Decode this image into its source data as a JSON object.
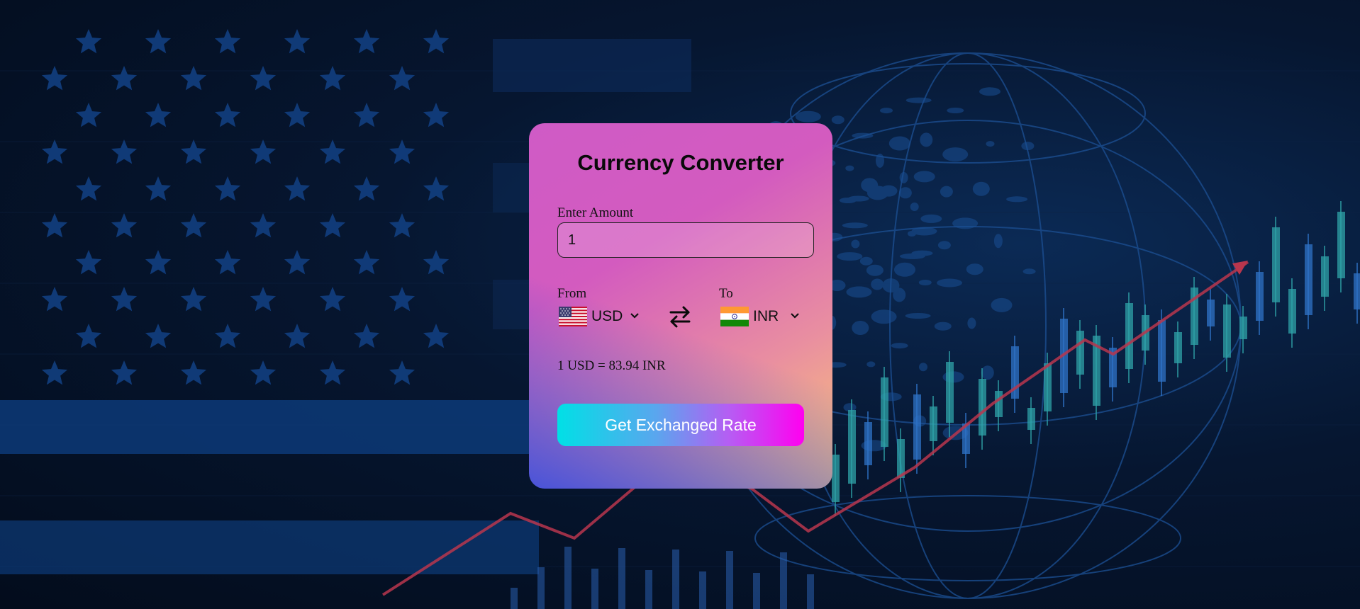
{
  "app": {
    "title": "Currency Converter"
  },
  "amount": {
    "label": "Enter Amount",
    "value": "1"
  },
  "from": {
    "label": "From",
    "currency": "USD",
    "flag_icon": "us-flag-icon"
  },
  "to": {
    "label": "To",
    "currency": "INR",
    "flag_icon": "india-flag-icon"
  },
  "rate": {
    "text": "1 USD = 83.94 INR"
  },
  "actions": {
    "convert_label": "Get Exchanged Rate"
  },
  "colors": {
    "card_gradient_start": "#cf5bc6",
    "card_gradient_end": "#fbc974",
    "button_gradient_start": "#00e0e6",
    "button_gradient_end": "#ff00f0",
    "background": "#061630"
  }
}
